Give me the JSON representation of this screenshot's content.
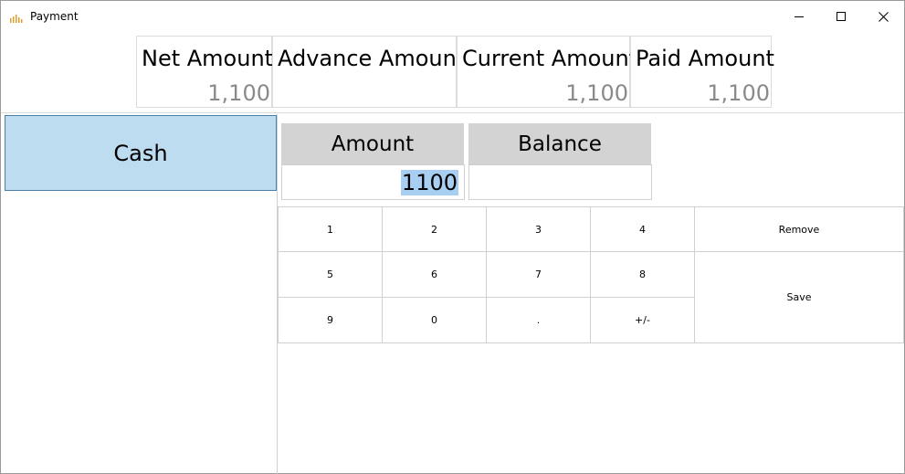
{
  "window": {
    "title": "Payment"
  },
  "summary": [
    {
      "label": "Net Amount",
      "value": "1,100"
    },
    {
      "label": "Advance Amount",
      "value": ""
    },
    {
      "label": "Current Amount",
      "value": "1,100"
    },
    {
      "label": "Paid Amount",
      "value": "1,100"
    }
  ],
  "payment_methods": [
    "Cash"
  ],
  "fields": {
    "amount": {
      "label": "Amount",
      "value": "1100"
    },
    "balance": {
      "label": "Balance",
      "value": ""
    }
  },
  "keypad": {
    "keys": [
      "1",
      "2",
      "3",
      "4",
      "5",
      "6",
      "7",
      "8",
      "9",
      "0",
      ".",
      "+/-"
    ],
    "remove_label": "Remove",
    "save_label": "Save"
  },
  "colors": {
    "selected_method_bg": "#bddcef",
    "field_header_bg": "#d3d3d3",
    "selection_highlight": "#a8cff2"
  }
}
